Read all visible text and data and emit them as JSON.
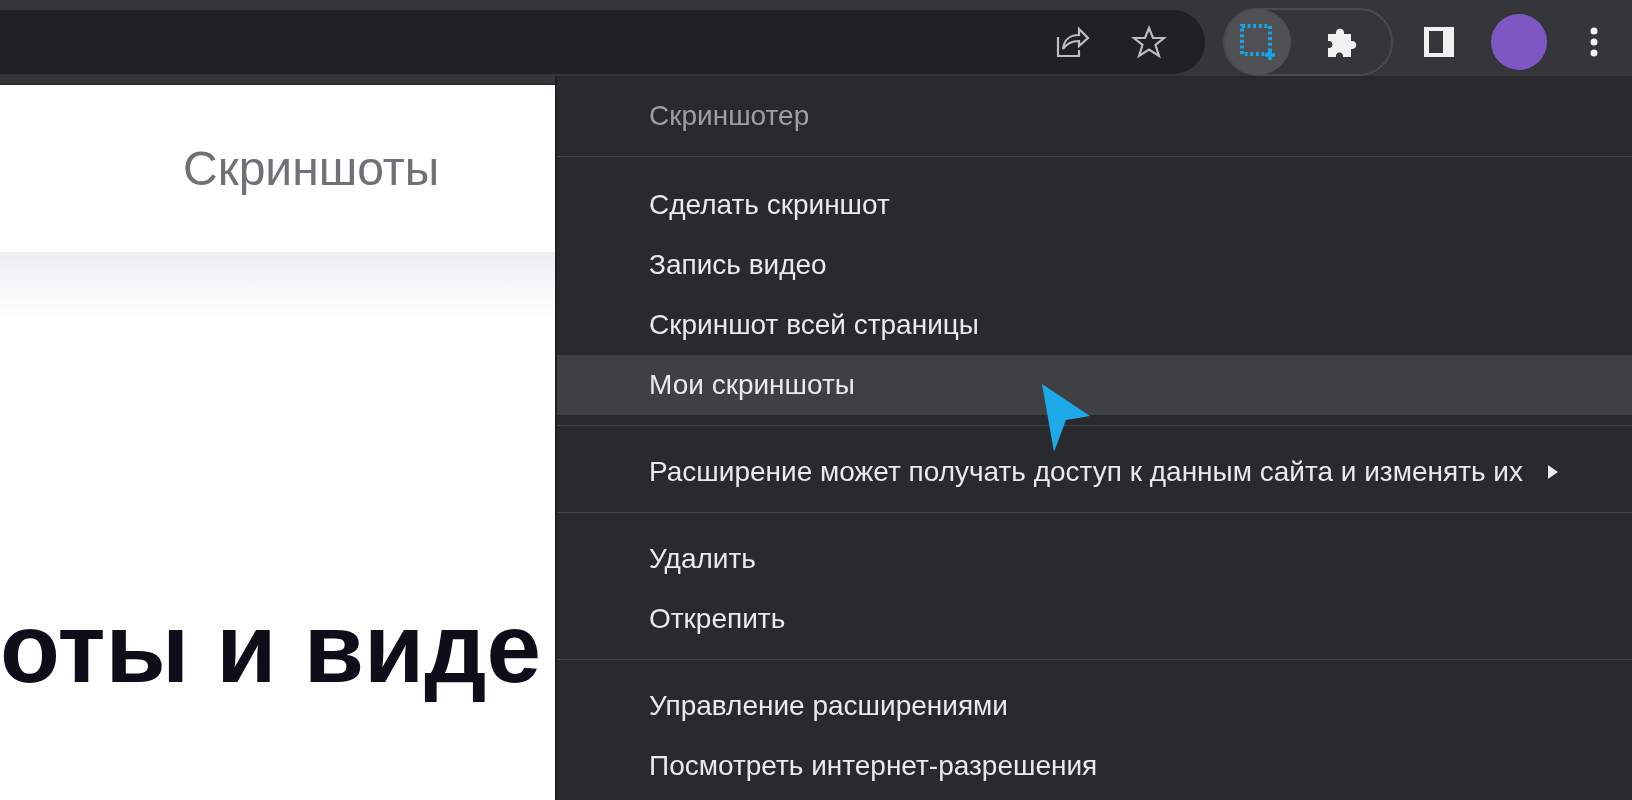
{
  "toolbar": {
    "extensions": [
      {
        "kind": "screenshot",
        "selected": true
      },
      {
        "kind": "puzzle",
        "selected": false
      }
    ]
  },
  "page": {
    "nav_link": "Скриншоты",
    "heading": "оты и виде"
  },
  "context_menu": {
    "title": "Скриншотер",
    "groups": [
      [
        {
          "label": "Сделать скриншот",
          "kind": "item",
          "selected": false
        },
        {
          "label": "Запись видео",
          "kind": "item",
          "selected": false
        },
        {
          "label": "Скриншот всей страницы",
          "kind": "item",
          "selected": false
        },
        {
          "label": "Мои скриншоты",
          "kind": "item",
          "selected": true
        }
      ],
      [
        {
          "label": "Расширение может получать доступ к данным сайта и изменять их",
          "kind": "submenu",
          "selected": false
        }
      ],
      [
        {
          "label": "Удалить",
          "kind": "item",
          "selected": false
        },
        {
          "label": "Открепить",
          "kind": "item",
          "selected": false
        }
      ],
      [
        {
          "label": "Управление расширениями",
          "kind": "item",
          "selected": false
        },
        {
          "label": "Посмотреть интернет-разрешения",
          "kind": "item",
          "selected": false
        }
      ]
    ]
  }
}
